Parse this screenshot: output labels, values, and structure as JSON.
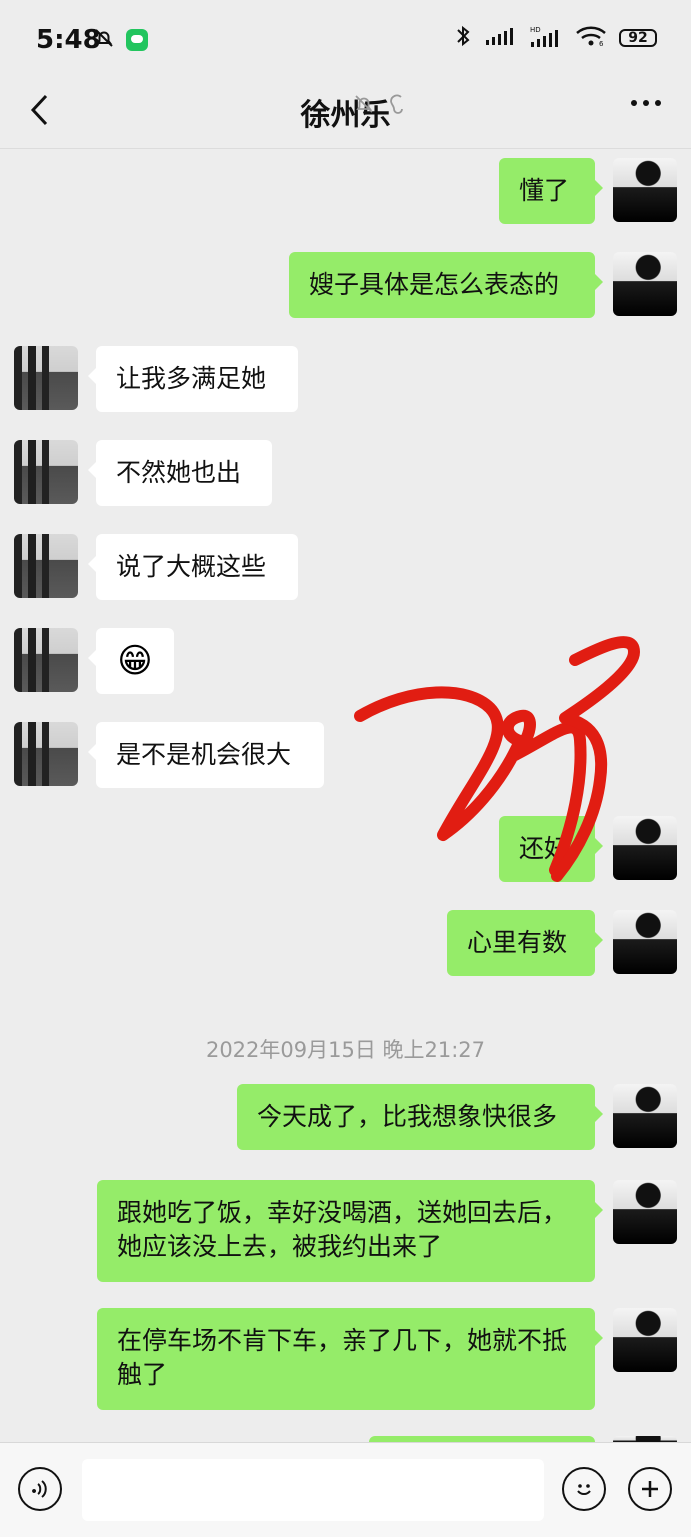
{
  "status_bar": {
    "time": "5:48",
    "battery": "92",
    "icons": [
      "bell-off-icon",
      "app-icon",
      "bluetooth-icon",
      "signal-icon",
      "hd-signal-icon",
      "wifi-icon",
      "battery-icon"
    ]
  },
  "header": {
    "title": "徐州乐",
    "icons": [
      "mute-icon",
      "earpiece-icon"
    ],
    "back_icon": "back-arrow-icon",
    "more_icon": "more-icon"
  },
  "messages": [
    {
      "side": "right",
      "text": "懂了"
    },
    {
      "side": "right",
      "text": "嫂子具体是怎么表态的"
    },
    {
      "side": "left",
      "text": "让我多满足她"
    },
    {
      "side": "left",
      "text": "不然她也出"
    },
    {
      "side": "left",
      "text": "说了大概这些"
    },
    {
      "side": "left",
      "type": "emoji",
      "text": "😁"
    },
    {
      "side": "left",
      "text": "是不是机会很大"
    },
    {
      "side": "right",
      "text": "还好"
    },
    {
      "side": "right",
      "text": "心里有数"
    },
    {
      "type": "timestamp",
      "text": "2022年09月15日 晚上21:27"
    },
    {
      "side": "right",
      "text": "今天成了，比我想象快很多"
    },
    {
      "side": "right",
      "text": "跟她吃了饭，幸好没喝酒，送她回去后，她应该没上去，被我约出来了"
    },
    {
      "side": "right",
      "text": "在停车场不肯下车，亲了几下，她就不抵触了"
    }
  ],
  "annotation": {
    "doodle_icon": "red-scribble-icon"
  },
  "input_bar": {
    "voice_icon": "voice-icon",
    "emoji_icon": "emoji-icon",
    "plus_icon": "plus-icon",
    "input_value": ""
  },
  "colors": {
    "background": "#ededed",
    "me_bubble": "#95ec69",
    "other_bubble": "#ffffff",
    "accent": "#e11d12"
  }
}
